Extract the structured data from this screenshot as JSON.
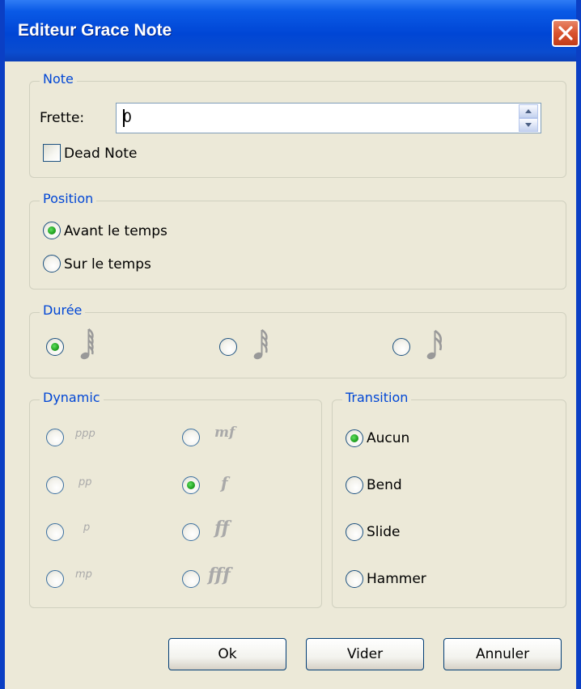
{
  "window": {
    "title": "Editeur Grace Note"
  },
  "note": {
    "legend": "Note",
    "fret_label": "Frette:",
    "fret_value": "0",
    "dead_note_label": "Dead Note",
    "dead_note_checked": false
  },
  "position": {
    "legend": "Position",
    "options": [
      {
        "label": "Avant le temps",
        "selected": true
      },
      {
        "label": "Sur le temps",
        "selected": false
      }
    ]
  },
  "duration": {
    "legend": "Durée",
    "options": [
      {
        "icon": "sixty-fourth-note-icon",
        "selected": true
      },
      {
        "icon": "thirty-second-note-icon",
        "selected": false
      },
      {
        "icon": "sixteenth-note-icon",
        "selected": false
      }
    ]
  },
  "dynamic": {
    "legend": "Dynamic",
    "options": [
      {
        "label": "ppp",
        "selected": false
      },
      {
        "label": "pp",
        "selected": false
      },
      {
        "label": "p",
        "selected": false
      },
      {
        "label": "mp",
        "selected": false
      },
      {
        "label": "mf",
        "selected": false
      },
      {
        "label": "f",
        "selected": true
      },
      {
        "label": "ff",
        "selected": false
      },
      {
        "label": "fff",
        "selected": false
      }
    ]
  },
  "transition": {
    "legend": "Transition",
    "options": [
      {
        "label": "Aucun",
        "selected": true
      },
      {
        "label": "Bend",
        "selected": false
      },
      {
        "label": "Slide",
        "selected": false
      },
      {
        "label": "Hammer",
        "selected": false
      }
    ]
  },
  "buttons": {
    "ok": "Ok",
    "clear": "Vider",
    "cancel": "Annuler"
  },
  "colors": {
    "titlebar": "#0046d5",
    "dialog_bg": "#ece9d8",
    "group_legend": "#0046d5",
    "radio_dot": "#21a121",
    "close_button": "#d9532e"
  }
}
